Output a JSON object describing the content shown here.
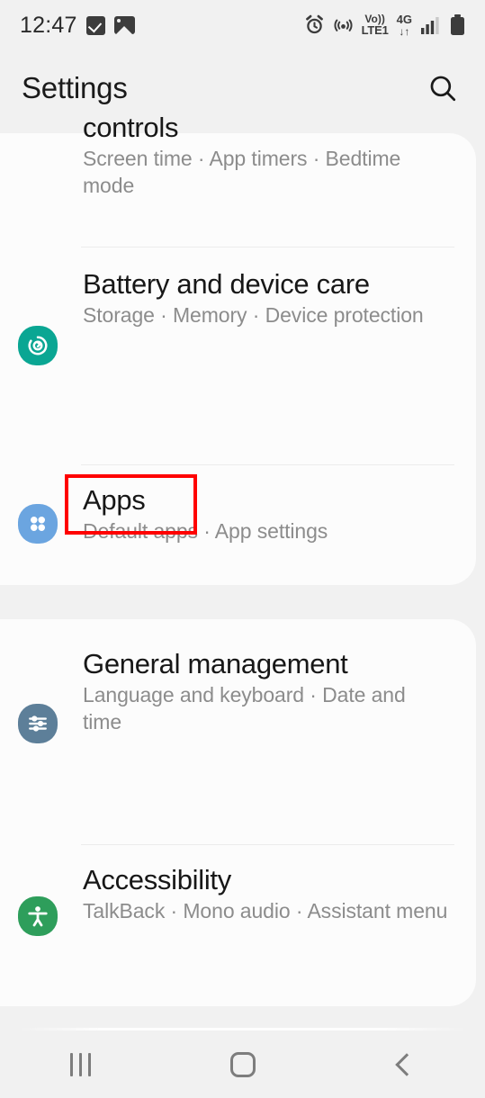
{
  "status_bar": {
    "time": "12:47",
    "left_icons": [
      "checkbox-checked-icon",
      "image-icon"
    ],
    "right_icons": [
      "alarm-icon",
      "hotspot-icon",
      "volte-icon",
      "4g-icon",
      "signal-icon",
      "battery-icon"
    ],
    "volte_line1": "Vo))",
    "volte_line2": "LTE1",
    "network_line1": "4G",
    "network_line2": "↓↑"
  },
  "app_bar": {
    "title": "Settings",
    "search_icon": "search-icon"
  },
  "sections": [
    {
      "name": "card-one",
      "rows": [
        {
          "id": "digital-wellbeing",
          "title": "controls",
          "title_clipped": true,
          "subtitle": "Screen time · App timers · Bedtime mode",
          "icon": "digital-wellbeing-icon",
          "icon_color": "#3f7bd0"
        },
        {
          "id": "battery-and-device-care",
          "title": "Battery and device care",
          "subtitle": "Storage · Memory · Device protection",
          "icon": "device-care-icon",
          "icon_color": "#0aa693"
        },
        {
          "id": "apps",
          "title": "Apps",
          "subtitle": "Default apps · App settings",
          "icon": "apps-icon",
          "icon_color": "#6ba5e0",
          "highlighted": true
        }
      ]
    },
    {
      "name": "card-two",
      "rows": [
        {
          "id": "general-management",
          "title": "General management",
          "subtitle": "Language and keyboard · Date and time",
          "icon": "sliders-icon",
          "icon_color": "#5d7f99"
        },
        {
          "id": "accessibility",
          "title": "Accessibility",
          "subtitle": "TalkBack · Mono audio · Assistant menu",
          "icon": "accessibility-icon",
          "icon_color": "#2e9e5b"
        }
      ]
    }
  ],
  "annotation": {
    "target": "apps-title",
    "color": "#ff0000"
  },
  "nav_bar": {
    "recents_label": "recents-icon",
    "home_label": "home-icon",
    "back_label": "back-icon"
  },
  "colors": {
    "page_background": "#f1f1f1",
    "card_background": "#fcfcfc",
    "title_text": "#171717",
    "subtitle_text": "#8c8c8c",
    "highlight": "#ff0000"
  }
}
